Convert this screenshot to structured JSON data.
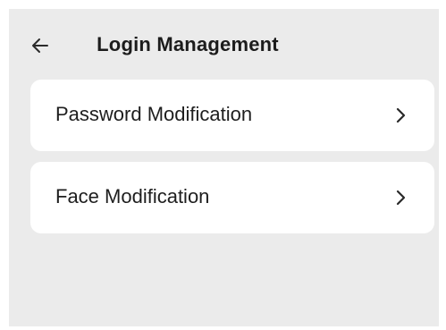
{
  "header": {
    "title": "Login Management",
    "back_icon": "arrow-left-icon"
  },
  "menu": {
    "items": [
      {
        "label": "Password Modification",
        "icon": "chevron-right-icon"
      },
      {
        "label": "Face Modification",
        "icon": "chevron-right-icon"
      }
    ]
  },
  "colors": {
    "background": "#ebebeb",
    "card": "#ffffff",
    "text": "#1e1e1e"
  }
}
